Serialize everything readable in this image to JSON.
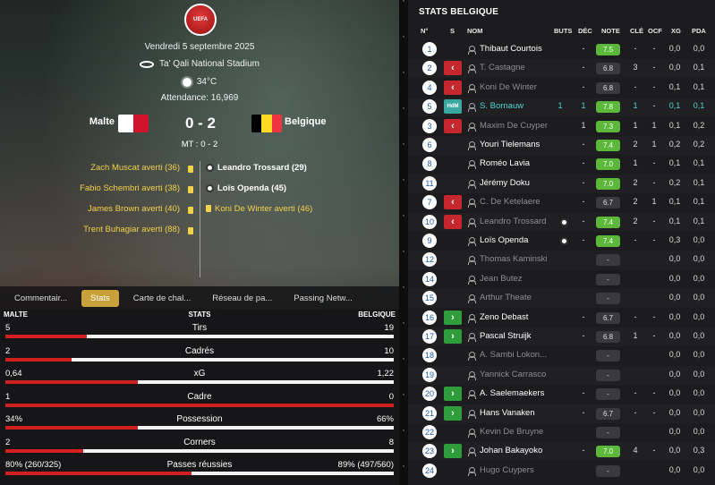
{
  "match": {
    "competition_logo": "UEFA",
    "date": "Vendredi 5 septembre 2025",
    "stadium": "Ta' Qali National Stadium",
    "temperature": "34°C",
    "attendance": "Attendance: 16,969",
    "home_team": "Malte",
    "away_team": "Belgique",
    "score": "0 - 2",
    "half_time": "MT : 0 - 2"
  },
  "events_home": [
    "Zach Muscat averti (36)",
    "Fabio Schembri averti (38)",
    "James Brown averti (40)",
    "Trent Buhagiar averti (88)"
  ],
  "events_away": [
    {
      "text": "Leandro Trossard (29)",
      "type": "goal"
    },
    {
      "text": "Loïs Openda (45)",
      "type": "goal"
    },
    {
      "text": "Koni De Winter averti (46)",
      "type": "card"
    }
  ],
  "tabs": [
    "Commentair...",
    "Stats",
    "Carte de chal...",
    "Réseau de pa...",
    "Passing Netw..."
  ],
  "active_tab": "Stats",
  "stats_header": {
    "home": "MALTE",
    "title": "STATS",
    "away": "BELGIQUE"
  },
  "stats": [
    {
      "label": "Tirs",
      "home": "5",
      "away": "19",
      "home_share": 0.21
    },
    {
      "label": "Cadrés",
      "home": "2",
      "away": "10",
      "home_share": 0.17
    },
    {
      "label": "xG",
      "home": "0,64",
      "away": "1,22",
      "home_share": 0.34
    },
    {
      "label": "Cadre",
      "home": "1",
      "away": "0",
      "home_share": 1.0
    },
    {
      "label": "Possession",
      "home": "34%",
      "away": "66%",
      "home_share": 0.34
    },
    {
      "label": "Corners",
      "home": "2",
      "away": "8",
      "home_share": 0.2
    },
    {
      "label": "Passes réussies",
      "home": "80% (260/325)",
      "away": "89% (497/560)",
      "home_share": 0.48
    }
  ],
  "right_panel": {
    "title": "STATS BELGIQUE",
    "columns": {
      "num": "N°",
      "s": "S",
      "name": "NOM",
      "buts": "BUTS",
      "dec": "DÉC",
      "note": "NOTE",
      "cle": "CLÉ",
      "ocf": "OCF",
      "xg": "XG",
      "pda": "PDA"
    }
  },
  "players": [
    {
      "num": "1",
      "sub": "",
      "name": "Thibaut Courtois",
      "style": "",
      "ball": false,
      "buts": "",
      "dec": "-",
      "note": "7.5",
      "rating": "good",
      "cle": "-",
      "ocf": "-",
      "xg": "0,0",
      "pda": "0,0"
    },
    {
      "num": "2",
      "sub": "out",
      "name": "T. Castagne",
      "style": "dim",
      "ball": false,
      "buts": "",
      "dec": "-",
      "note": "6.8",
      "rating": "mid",
      "cle": "3",
      "ocf": "-",
      "xg": "0,0",
      "pda": "0,1"
    },
    {
      "num": "4",
      "sub": "out",
      "name": "Koni De Winter",
      "style": "dim",
      "ball": false,
      "buts": "",
      "dec": "-",
      "note": "6.8",
      "rating": "mid",
      "cle": "-",
      "ocf": "-",
      "xg": "0,1",
      "pda": "0,1"
    },
    {
      "num": "5",
      "sub": "motm",
      "name": "S. Bornauw",
      "style": "teal",
      "ball": false,
      "buts": "1",
      "dec": "1",
      "note": "7.8",
      "rating": "good",
      "cle": "1",
      "ocf": "-",
      "xg": "0,1",
      "pda": "0,1"
    },
    {
      "num": "3",
      "sub": "out",
      "name": "Maxim De Cuyper",
      "style": "dim",
      "ball": false,
      "buts": "",
      "dec": "1",
      "note": "7.3",
      "rating": "good",
      "cle": "1",
      "ocf": "1",
      "xg": "0,1",
      "pda": "0,2"
    },
    {
      "num": "6",
      "sub": "",
      "name": "Youri Tielemans",
      "style": "",
      "ball": false,
      "buts": "",
      "dec": "-",
      "note": "7.4",
      "rating": "good",
      "cle": "2",
      "ocf": "1",
      "xg": "0,2",
      "pda": "0,2"
    },
    {
      "num": "8",
      "sub": "",
      "name": "Roméo Lavia",
      "style": "",
      "ball": false,
      "buts": "",
      "dec": "-",
      "note": "7.0",
      "rating": "good",
      "cle": "1",
      "ocf": "-",
      "xg": "0,1",
      "pda": "0,1"
    },
    {
      "num": "11",
      "sub": "",
      "name": "Jérémy Doku",
      "style": "",
      "ball": false,
      "buts": "",
      "dec": "-",
      "note": "7.0",
      "rating": "good",
      "cle": "2",
      "ocf": "-",
      "xg": "0,2",
      "pda": "0,1"
    },
    {
      "num": "7",
      "sub": "out",
      "name": "C. De Ketelaere",
      "style": "dim",
      "ball": false,
      "buts": "",
      "dec": "-",
      "note": "6.7",
      "rating": "mid",
      "cle": "2",
      "ocf": "1",
      "xg": "0,1",
      "pda": "0,1"
    },
    {
      "num": "10",
      "sub": "out",
      "name": "Leandro Trossard",
      "style": "dim",
      "ball": true,
      "buts": "",
      "dec": "-",
      "note": "7.4",
      "rating": "good",
      "cle": "2",
      "ocf": "-",
      "xg": "0,1",
      "pda": "0,1"
    },
    {
      "num": "9",
      "sub": "",
      "name": "Loïs Openda",
      "style": "",
      "ball": true,
      "buts": "",
      "dec": "-",
      "note": "7.4",
      "rating": "good",
      "cle": "-",
      "ocf": "-",
      "xg": "0,3",
      "pda": "0,0"
    },
    {
      "num": "12",
      "sub": "",
      "name": "Thomas Kaminski",
      "style": "dim",
      "ball": false,
      "buts": "",
      "dec": "",
      "note": "-",
      "rating": "mid",
      "cle": "",
      "ocf": "",
      "xg": "0,0",
      "pda": "0,0"
    },
    {
      "num": "14",
      "sub": "",
      "name": "Jean Butez",
      "style": "dim",
      "ball": false,
      "buts": "",
      "dec": "",
      "note": "-",
      "rating": "mid",
      "cle": "",
      "ocf": "",
      "xg": "0,0",
      "pda": "0,0"
    },
    {
      "num": "15",
      "sub": "",
      "name": "Arthur Theate",
      "style": "dim",
      "ball": false,
      "buts": "",
      "dec": "",
      "note": "-",
      "rating": "mid",
      "cle": "",
      "ocf": "",
      "xg": "0,0",
      "pda": "0,0"
    },
    {
      "num": "16",
      "sub": "in",
      "name": "Zeno Debast",
      "style": "",
      "ball": false,
      "buts": "",
      "dec": "-",
      "note": "6.7",
      "rating": "mid",
      "cle": "-",
      "ocf": "-",
      "xg": "0,0",
      "pda": "0,0"
    },
    {
      "num": "17",
      "sub": "in",
      "name": "Pascal Struijk",
      "style": "",
      "ball": false,
      "buts": "",
      "dec": "-",
      "note": "6.8",
      "rating": "mid",
      "cle": "1",
      "ocf": "-",
      "xg": "0,0",
      "pda": "0,0"
    },
    {
      "num": "18",
      "sub": "",
      "name": "A. Sambi Lokon...",
      "style": "dim",
      "ball": false,
      "buts": "",
      "dec": "",
      "note": "-",
      "rating": "mid",
      "cle": "",
      "ocf": "",
      "xg": "0,0",
      "pda": "0,0"
    },
    {
      "num": "19",
      "sub": "",
      "name": "Yannick Carrasco",
      "style": "dim",
      "ball": false,
      "buts": "",
      "dec": "",
      "note": "-",
      "rating": "mid",
      "cle": "",
      "ocf": "",
      "xg": "0,0",
      "pda": "0,0"
    },
    {
      "num": "20",
      "sub": "in",
      "name": "A. Saelemaekers",
      "style": "",
      "ball": false,
      "buts": "",
      "dec": "-",
      "note": "-",
      "rating": "mid",
      "cle": "-",
      "ocf": "-",
      "xg": "0,0",
      "pda": "0,0"
    },
    {
      "num": "21",
      "sub": "in",
      "name": "Hans Vanaken",
      "style": "",
      "ball": false,
      "buts": "",
      "dec": "-",
      "note": "6.7",
      "rating": "mid",
      "cle": "-",
      "ocf": "-",
      "xg": "0,0",
      "pda": "0,0"
    },
    {
      "num": "22",
      "sub": "",
      "name": "Kevin De Bruyne",
      "style": "dim",
      "ball": false,
      "buts": "",
      "dec": "",
      "note": "-",
      "rating": "mid",
      "cle": "",
      "ocf": "",
      "xg": "0,0",
      "pda": "0,0"
    },
    {
      "num": "23",
      "sub": "in",
      "name": "Johan Bakayoko",
      "style": "",
      "ball": false,
      "buts": "",
      "dec": "-",
      "note": "7.0",
      "rating": "good",
      "cle": "4",
      "ocf": "-",
      "xg": "0,0",
      "pda": "0,3"
    },
    {
      "num": "24",
      "sub": "",
      "name": "Hugo Cuypers",
      "style": "dim",
      "ball": false,
      "buts": "",
      "dec": "",
      "note": "-",
      "rating": "mid",
      "cle": "",
      "ocf": "",
      "xg": "0,0",
      "pda": "0,0"
    }
  ],
  "colors": {
    "accent_gold": "#c9a13a",
    "card_yellow": "#f2d14b",
    "bar_red": "#d21f1f",
    "rating_green": "#5bb83a",
    "sub_out": "#c6262e",
    "sub_in": "#2f9d3b",
    "motm_teal": "#3aa7a0"
  }
}
